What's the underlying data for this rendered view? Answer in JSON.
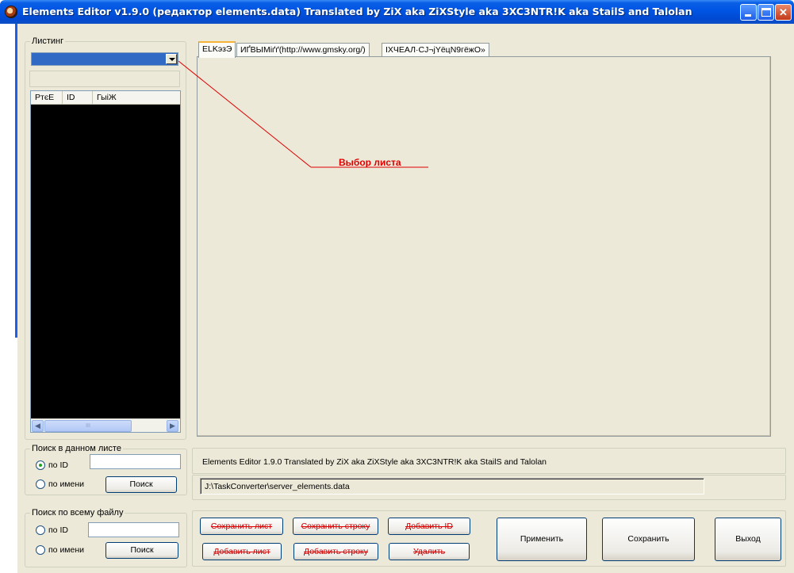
{
  "window": {
    "title": "Elements Editor v1.9.0 (редактор elements.data) Translated by ZiX aka ZiXStyle aka 3XC3NTR!K aka StailS and Talolan"
  },
  "listing": {
    "group_label": "Листинг",
    "columns": [
      "РтєЕ",
      "ID",
      "ГыіЖ"
    ]
  },
  "tabs": [
    "ELKэзЭ",
    "ИҐВЫМіґґ(http://www.gmsky.org/)",
    "ІХЧЕАЛ·СЈ¬јYёцN9гёжО»"
  ],
  "annotation": {
    "text": "Выбор листа",
    "color": "#e00000"
  },
  "search_sheet": {
    "label": "Поиск в данном листе",
    "by_id": "по ID",
    "by_name": "по имени",
    "button": "Поиск",
    "id_value": ""
  },
  "search_file": {
    "label": "Поиск по всему файлу",
    "by_id": "по ID",
    "by_name": "по имени",
    "button": "Поиск",
    "id_value": ""
  },
  "status": {
    "info": "Elements Editor 1.9.0 Translated by ZiX aka ZiXStyle aka 3XC3NTR!K aka StailS and Talolan",
    "path": "J:\\TaskConverter\\server_elements.data"
  },
  "actions": {
    "save_sheet": "Сохранить лист",
    "save_row": "Сохранить строку",
    "add_id": "Добавить ID",
    "add_sheet": "Добавить лист",
    "add_row": "Добавить строку",
    "delete": "Удалить",
    "apply": "Применить",
    "save": "Сохранить",
    "exit": "Выход"
  },
  "scrollbar": {
    "thumb_grip": "III"
  }
}
